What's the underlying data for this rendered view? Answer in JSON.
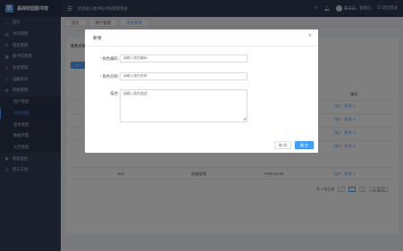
{
  "app": {
    "logo_mark": "B",
    "title": "基础校园图书馆",
    "menu_toggle": "☰",
    "welcome": "欢迎进入图书馆书馆管理系统"
  },
  "header_right": {
    "user": "曲晶晶，管理员",
    "logout": "退出登录"
  },
  "sidebar": {
    "items": [
      {
        "label": "首页",
        "icon": "⌂"
      },
      {
        "label": "书刊管理",
        "icon": "▤",
        "arrow": "›"
      },
      {
        "label": "借还管理",
        "icon": "⇄",
        "arrow": "›"
      },
      {
        "label": "图书馆管理",
        "icon": "▦",
        "arrow": "›"
      },
      {
        "label": "读者管理",
        "icon": "☺",
        "arrow": "›"
      },
      {
        "label": "馆藏查询",
        "icon": "⌕",
        "arrow": "›"
      },
      {
        "label": "系统管理",
        "icon": "⚙",
        "arrow": "⌃"
      }
    ],
    "subitems": [
      {
        "label": "用户管理"
      },
      {
        "label": "角色管理"
      },
      {
        "label": "菜单管理"
      },
      {
        "label": "数据字典"
      },
      {
        "label": "公告管理"
      }
    ],
    "bottom_items": [
      {
        "label": "系统监控",
        "icon": "◉",
        "arrow": "›"
      },
      {
        "label": "第三方接",
        "icon": "⚲",
        "arrow": "›"
      }
    ]
  },
  "tabs": [
    {
      "label": "首页"
    },
    {
      "label": "用户管理"
    },
    {
      "label": "角色管理"
    }
  ],
  "card": {
    "title": "角色名称",
    "add_label": "+"
  },
  "table": {
    "operation_header": "操作",
    "row_actions": [
      "用户",
      "更多 ∨"
    ],
    "last_row": {
      "col1": "test",
      "col2": "低级管理",
      "col3": "2019-12-20"
    }
  },
  "pager": {
    "total": "共 4 条记录",
    "prev": "‹",
    "page": "1",
    "next": "›",
    "size": "10 条/页"
  },
  "dialog": {
    "title": "新增",
    "close": "×",
    "fields": [
      {
        "label": "角色编码:",
        "required": true,
        "placeholder": "请输入角色编码"
      },
      {
        "label": "角色名称:",
        "required": true,
        "placeholder": "请输入角色名称"
      }
    ],
    "description": {
      "label": "描述:",
      "placeholder": "请输入角色描述"
    },
    "cancel_label": "取 消",
    "ok_label": "确 定"
  }
}
